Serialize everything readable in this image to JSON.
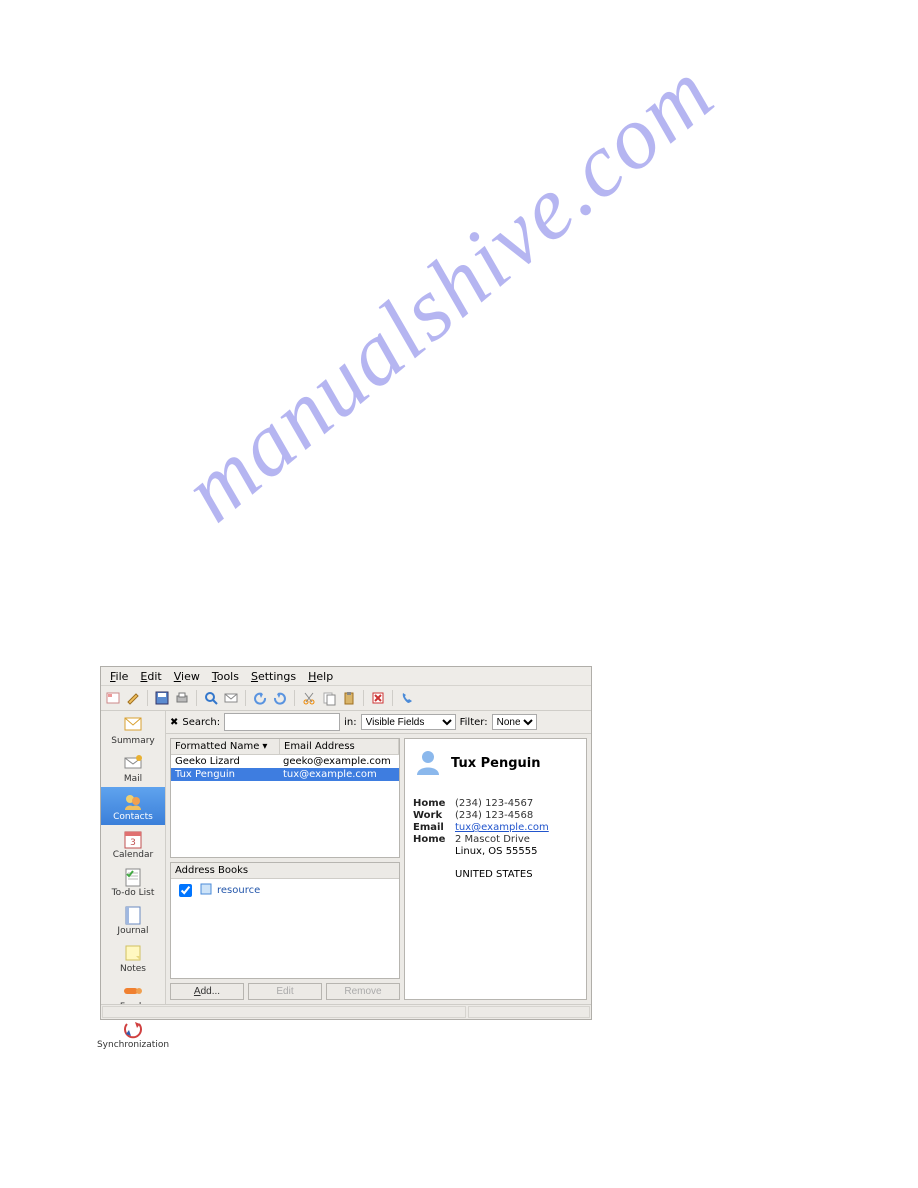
{
  "watermark": "manualshive.com",
  "menu": {
    "file": "File",
    "edit": "Edit",
    "view": "View",
    "tools": "Tools",
    "settings": "Settings",
    "help": "Help"
  },
  "search": {
    "label": "Search:",
    "value": "",
    "in_label": "in:",
    "in_value": "Visible Fields",
    "filter_label": "Filter:",
    "filter_value": "None"
  },
  "sidebar": {
    "items": [
      {
        "label": "Summary"
      },
      {
        "label": "Mail"
      },
      {
        "label": "Contacts"
      },
      {
        "label": "Calendar"
      },
      {
        "label": "To-do List"
      },
      {
        "label": "Journal"
      },
      {
        "label": "Notes"
      },
      {
        "label": "Feeds"
      },
      {
        "label": "Synchronization"
      }
    ],
    "selected_index": 2
  },
  "list": {
    "columns": [
      "Formatted Name",
      "Email Address"
    ],
    "rows": [
      {
        "name": "Geeko Lizard",
        "email": "geeko@example.com"
      },
      {
        "name": "Tux Penguin",
        "email": "tux@example.com"
      }
    ],
    "selected_index": 1
  },
  "addressbook": {
    "title": "Address Books",
    "items": [
      {
        "label": "resource",
        "checked": true
      }
    ]
  },
  "buttons": {
    "add": "Add...",
    "edit": "Edit",
    "remove": "Remove"
  },
  "detail": {
    "name": "Tux Penguin",
    "fields": [
      {
        "label": "Home",
        "value": "(234) 123-4567"
      },
      {
        "label": "Work",
        "value": "(234) 123-4568"
      },
      {
        "label": "Email",
        "value": "tux@example.com",
        "link": true
      },
      {
        "label": "Home",
        "value": "2 Mascot Drive"
      }
    ],
    "addr2": "Linux, OS 55555",
    "country": "UNITED STATES"
  }
}
